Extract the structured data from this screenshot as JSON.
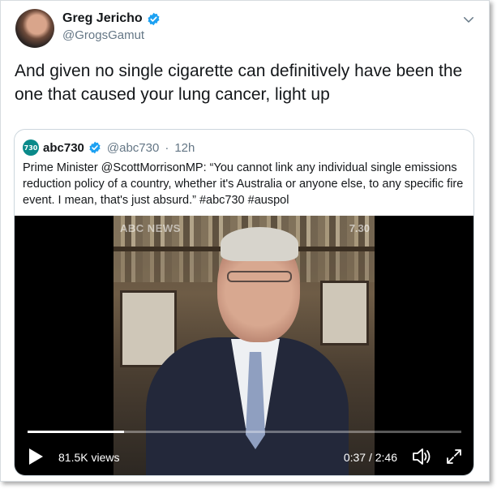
{
  "tweet": {
    "author": {
      "name": "Greg Jericho",
      "handle": "@GrogsGamut",
      "verified": true
    },
    "text": "And given no single cigarette can definitively have been the one that caused your lung cancer, light up"
  },
  "quoted_tweet": {
    "author": {
      "name": "abc730",
      "handle": "@abc730",
      "verified": true,
      "avatar_text": "730"
    },
    "separator": "·",
    "time": "12h",
    "text": "Prime Minister @ScottMorrisonMP: “You cannot link any individual single emissions reduction policy of a country, whether it's Australia or anyone else, to any specific fire event. I mean, that's just absurd.” #abc730 #auspol"
  },
  "video": {
    "watermark": "ABC NEWS",
    "badge": "7.30",
    "views": "81.5K views",
    "time": "0:37 / 2:46",
    "progress": 0.223
  },
  "icons": {
    "verified": "verified-badge-icon",
    "menu": "chevron-down-icon",
    "play": "play-icon",
    "volume": "volume-icon",
    "fullscreen": "fullscreen-icon"
  },
  "colors": {
    "verified": "#1da1f2",
    "abc_teal": "#0a8a8a",
    "muted": "#657786"
  }
}
